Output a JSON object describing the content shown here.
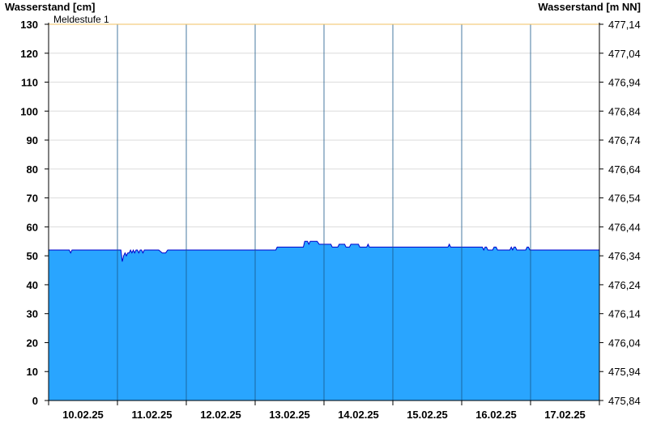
{
  "chart_data": {
    "type": "area",
    "left_axis_title": "Wasserstand [cm]",
    "right_axis_title": "Wasserstand [m NN]",
    "threshold": {
      "label": "Meldestufe 1",
      "value": 130,
      "color": "#f0c060"
    },
    "ylim": [
      0,
      130
    ],
    "left_ticks": [
      0,
      10,
      20,
      30,
      40,
      50,
      60,
      70,
      80,
      90,
      100,
      110,
      120,
      130
    ],
    "right_ticks": [
      "475,84",
      "475,94",
      "476,04",
      "476,14",
      "476,24",
      "476,34",
      "476,44",
      "476,54",
      "476,64",
      "476,74",
      "476,84",
      "476,94",
      "477,04",
      "477,14"
    ],
    "xlim_days": [
      0,
      8
    ],
    "x_tick_labels": [
      "10.02.25",
      "11.02.25",
      "12.02.25",
      "13.02.25",
      "14.02.25",
      "15.02.25",
      "16.02.25",
      "17.02.25"
    ],
    "fill_color": "#29a5ff",
    "line_color": "#0000cc",
    "series": [
      {
        "points": [
          [
            0.0,
            52
          ],
          [
            0.3,
            52
          ],
          [
            0.32,
            51
          ],
          [
            0.34,
            52
          ],
          [
            1.0,
            52
          ],
          [
            1.05,
            52
          ],
          [
            1.07,
            48
          ],
          [
            1.09,
            50
          ],
          [
            1.11,
            51
          ],
          [
            1.13,
            50
          ],
          [
            1.15,
            51
          ],
          [
            1.17,
            51
          ],
          [
            1.19,
            52
          ],
          [
            1.21,
            51
          ],
          [
            1.23,
            52
          ],
          [
            1.25,
            51
          ],
          [
            1.27,
            52
          ],
          [
            1.29,
            52
          ],
          [
            1.31,
            51
          ],
          [
            1.33,
            52
          ],
          [
            1.35,
            52
          ],
          [
            1.37,
            51
          ],
          [
            1.39,
            52
          ],
          [
            1.6,
            52
          ],
          [
            1.65,
            51
          ],
          [
            1.7,
            51
          ],
          [
            1.73,
            52
          ],
          [
            3.3,
            52
          ],
          [
            3.32,
            53
          ],
          [
            3.7,
            53
          ],
          [
            3.72,
            55
          ],
          [
            3.76,
            55
          ],
          [
            3.78,
            54
          ],
          [
            3.8,
            55
          ],
          [
            3.9,
            55
          ],
          [
            3.93,
            54
          ],
          [
            4.1,
            54
          ],
          [
            4.12,
            53
          ],
          [
            4.2,
            53
          ],
          [
            4.22,
            54
          ],
          [
            4.3,
            54
          ],
          [
            4.32,
            53
          ],
          [
            4.37,
            53
          ],
          [
            4.39,
            54
          ],
          [
            4.5,
            54
          ],
          [
            4.52,
            53
          ],
          [
            4.62,
            53
          ],
          [
            4.64,
            54
          ],
          [
            4.66,
            53
          ],
          [
            5.0,
            53
          ],
          [
            5.8,
            53
          ],
          [
            5.82,
            54
          ],
          [
            5.84,
            53
          ],
          [
            6.3,
            53
          ],
          [
            6.32,
            52
          ],
          [
            6.34,
            53
          ],
          [
            6.36,
            53
          ],
          [
            6.38,
            52
          ],
          [
            6.45,
            52
          ],
          [
            6.47,
            53
          ],
          [
            6.5,
            53
          ],
          [
            6.52,
            52
          ],
          [
            6.7,
            52
          ],
          [
            6.72,
            53
          ],
          [
            6.74,
            52
          ],
          [
            6.76,
            53
          ],
          [
            6.78,
            53
          ],
          [
            6.8,
            52
          ],
          [
            6.93,
            52
          ],
          [
            6.95,
            53
          ],
          [
            6.97,
            53
          ],
          [
            6.99,
            52
          ],
          [
            7.01,
            52
          ],
          [
            8.0,
            52
          ]
        ]
      }
    ]
  }
}
